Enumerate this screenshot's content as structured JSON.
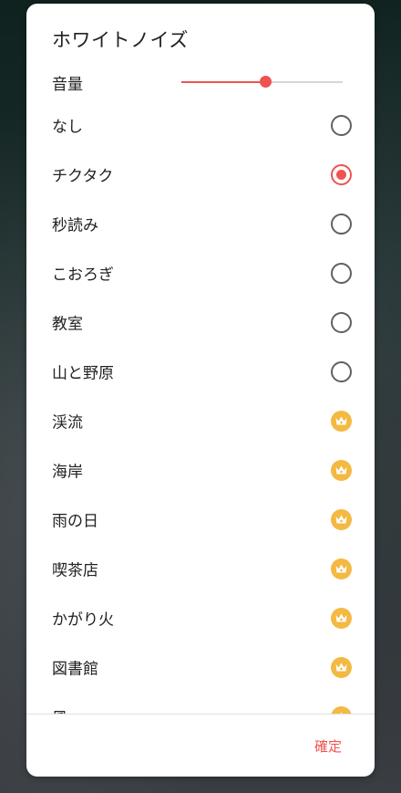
{
  "dialog": {
    "title": "ホワイトノイズ",
    "volume_label": "音量",
    "volume_level": 0.52,
    "confirm_label": "確定"
  },
  "colors": {
    "accent": "#ef5350",
    "premium_badge": "#f4b942",
    "radio_unchecked": "#616161"
  },
  "sounds": [
    {
      "label": "なし",
      "type": "radio",
      "selected": false
    },
    {
      "label": "チクタク",
      "type": "radio",
      "selected": true
    },
    {
      "label": "秒読み",
      "type": "radio",
      "selected": false
    },
    {
      "label": "こおろぎ",
      "type": "radio",
      "selected": false
    },
    {
      "label": "教室",
      "type": "radio",
      "selected": false
    },
    {
      "label": "山と野原",
      "type": "radio",
      "selected": false
    },
    {
      "label": "渓流",
      "type": "premium",
      "icon": "crown-icon"
    },
    {
      "label": "海岸",
      "type": "premium",
      "icon": "crown-icon"
    },
    {
      "label": "雨の日",
      "type": "premium",
      "icon": "crown-icon"
    },
    {
      "label": "喫茶店",
      "type": "premium",
      "icon": "crown-icon"
    },
    {
      "label": "かがり火",
      "type": "premium",
      "icon": "crown-icon"
    },
    {
      "label": "図書館",
      "type": "premium",
      "icon": "crown-icon"
    },
    {
      "label": "風",
      "type": "premium",
      "icon": "crown-icon"
    }
  ]
}
